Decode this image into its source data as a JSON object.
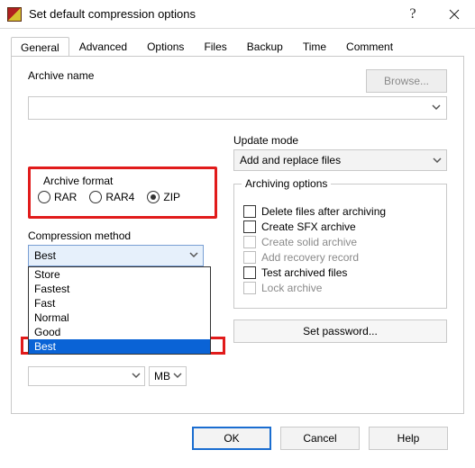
{
  "window": {
    "title": "Set default compression options"
  },
  "tabs": [
    "General",
    "Advanced",
    "Options",
    "Files",
    "Backup",
    "Time",
    "Comment"
  ],
  "active_tab": "General",
  "archive_name": {
    "label": "Archive name",
    "value": ""
  },
  "browse_label": "Browse...",
  "update_mode": {
    "label": "Update mode",
    "value": "Add and replace files"
  },
  "archive_format": {
    "legend": "Archive format",
    "options": [
      "RAR",
      "RAR4",
      "ZIP"
    ],
    "selected": "ZIP"
  },
  "compression_method": {
    "label": "Compression method",
    "value": "Best",
    "options": [
      "Store",
      "Fastest",
      "Fast",
      "Normal",
      "Good",
      "Best"
    ],
    "highlighted": "Best"
  },
  "split_unit": "MB",
  "archiving_options": {
    "legend": "Archiving options",
    "items": [
      {
        "label": "Delete files after archiving",
        "disabled": false
      },
      {
        "label": "Create SFX archive",
        "disabled": false
      },
      {
        "label": "Create solid archive",
        "disabled": true
      },
      {
        "label": "Add recovery record",
        "disabled": true
      },
      {
        "label": "Test archived files",
        "disabled": false
      },
      {
        "label": "Lock archive",
        "disabled": true
      }
    ]
  },
  "set_password_label": "Set password...",
  "buttons": {
    "ok": "OK",
    "cancel": "Cancel",
    "help": "Help"
  }
}
